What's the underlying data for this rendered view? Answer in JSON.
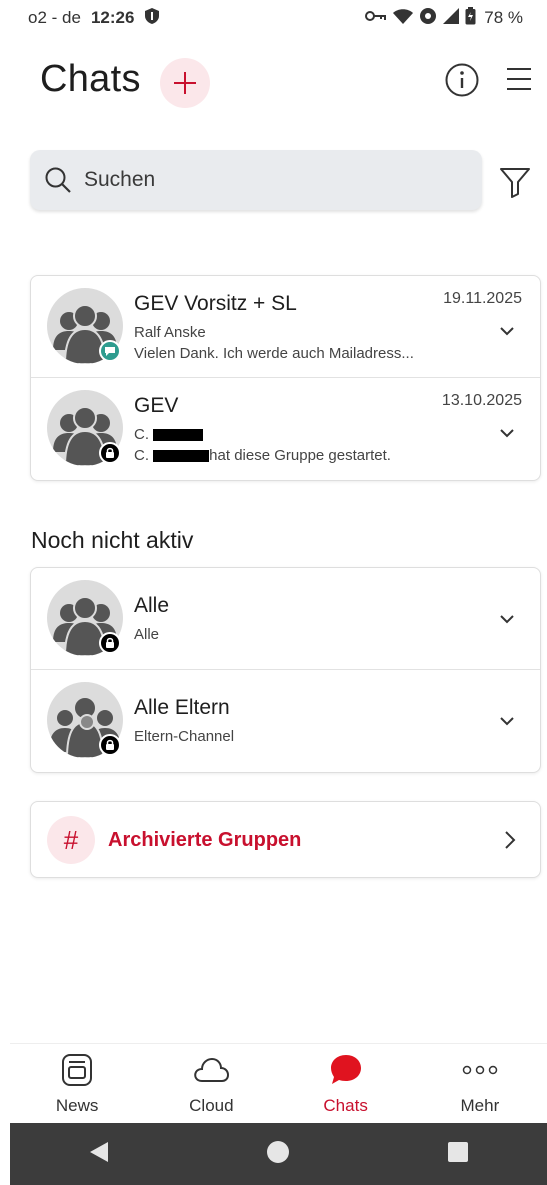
{
  "statusbar": {
    "carrier": "o2 - de",
    "time": "12:26",
    "battery": "78 %"
  },
  "header": {
    "title": "Chats"
  },
  "search": {
    "placeholder": "Suchen"
  },
  "chats": [
    {
      "title": "GEV Vorsitz + SL",
      "date": "19.11.2025",
      "sender": "Ralf Anske",
      "preview": "Vielen Dank. Ich werde auch Mailadress...",
      "badge": "chat-badge"
    },
    {
      "title": "GEV",
      "date": "13.10.2025",
      "sender": "C.",
      "preview_prefix": "C.",
      "preview": "hat diese Gruppe gestartet.",
      "badge": "lock-badge"
    }
  ],
  "inactive": {
    "title": "Noch nicht aktiv",
    "items": [
      {
        "title": "Alle",
        "subtitle": "Alle",
        "badge": "lock-badge"
      },
      {
        "title": "Alle Eltern",
        "subtitle": "Eltern-Channel",
        "badge": "lock-badge"
      }
    ]
  },
  "archived": {
    "label": "Archivierte Gruppen",
    "icon": "#"
  },
  "bottom_nav": [
    {
      "label": "News",
      "icon": "news-icon",
      "active": false
    },
    {
      "label": "Cloud",
      "icon": "cloud-icon",
      "active": false
    },
    {
      "label": "Chats",
      "icon": "chat-bubble-icon",
      "active": true
    },
    {
      "label": "Mehr",
      "icon": "more-dots-icon",
      "active": false
    }
  ],
  "colors": {
    "accent": "#c8102e",
    "accent_soft": "#fbe7ea",
    "chat_badge": "#2e9c8f"
  }
}
